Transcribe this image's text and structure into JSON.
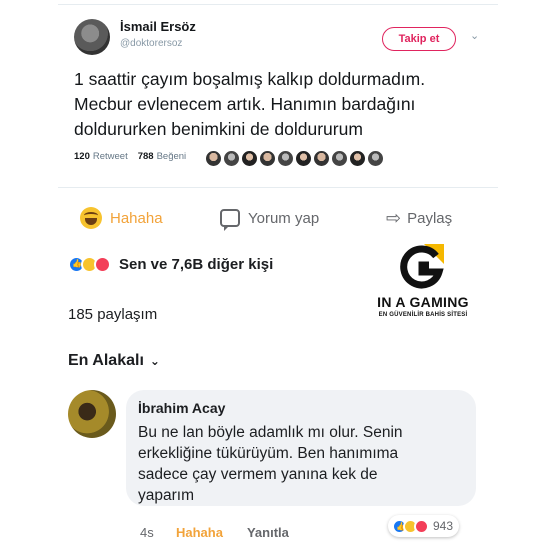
{
  "tweet": {
    "author_name": "İsmail Ersöz",
    "author_handle": "@doktorersoz",
    "follow_label": "Takip et",
    "caret": "⌄",
    "text_line1": "1 saattir çayım boşalmış kalkıp doldurmadım.",
    "text_line2": "Mecbur evlenecem artık. Hanımın bardağını",
    "text_line3": "doldururken benimkini de doldururum",
    "retweet_count": "120",
    "retweet_label": "Retweet",
    "like_count": "788",
    "like_label": "Beğeni"
  },
  "actions": {
    "haha_label": "Hahaha",
    "comment_label": "Yorum yap",
    "share_label": "Paylaş"
  },
  "reactions": {
    "summary": "Sen ve 7,6B diğer kişi"
  },
  "shares_label": "185 paylaşım",
  "sort_label": "En Alakalı",
  "comment": {
    "author": "İbrahim Acay",
    "line1": "Bu ne lan böyle adamlık mı olur. Senin",
    "line2": "erkekliğine tükürüyüm. Ben hanımıma",
    "line3": "sadece çay vermem yanına kek de",
    "line4": "yaparım",
    "time": "4s",
    "haha_label": "Hahaha",
    "reply_label": "Yanıtla",
    "reaction_count": "943"
  },
  "watermark": {
    "brand": "IN A GAMING",
    "tagline": "EN GÜVENİLİR BAHİS SİTESİ",
    "accent": "#f5b800"
  }
}
